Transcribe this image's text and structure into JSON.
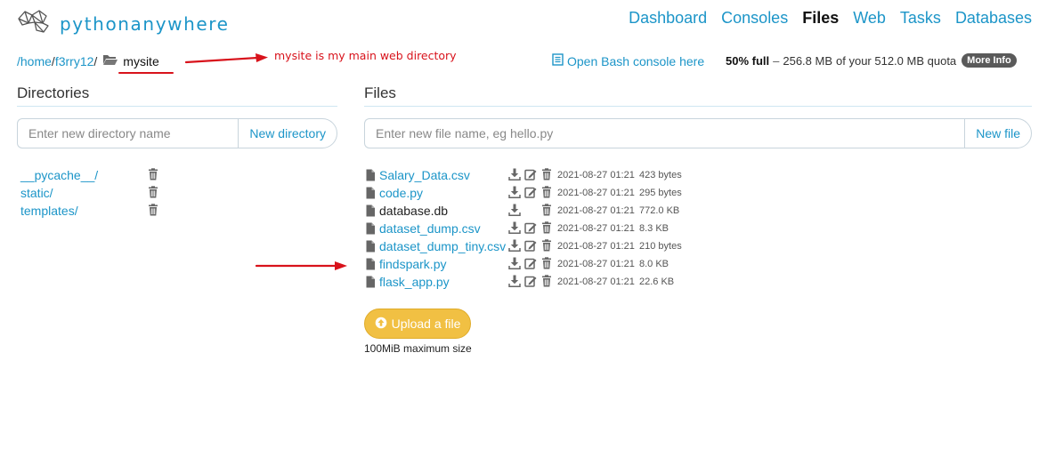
{
  "header": {
    "logo_text": "pythonanywhere",
    "nav": [
      {
        "label": "Dashboard",
        "active": false
      },
      {
        "label": "Consoles",
        "active": false
      },
      {
        "label": "Files",
        "active": true
      },
      {
        "label": "Web",
        "active": false
      },
      {
        "label": "Tasks",
        "active": false
      },
      {
        "label": "Databases",
        "active": false
      }
    ]
  },
  "breadcrumb": {
    "parts": [
      "/home",
      "/",
      "f3rry12",
      "/"
    ],
    "current": "mysite"
  },
  "annotation": {
    "text": "mysite is my main web directory",
    "color": "#d8121b"
  },
  "bash_link": "Open Bash console here",
  "quota": {
    "percent": "50% full",
    "dash": "–",
    "used": "256.8 MB",
    "of_text": "of your 512.0 MB quota",
    "more_info": "More Info"
  },
  "directories": {
    "title": "Directories",
    "placeholder": "Enter new directory name",
    "button": "New directory",
    "items": [
      "__pycache__/",
      "static/",
      "templates/"
    ]
  },
  "files": {
    "title": "Files",
    "placeholder": "Enter new file name, eg hello.py",
    "button": "New file",
    "items": [
      {
        "name": "Salary_Data.csv",
        "link": true,
        "edit": true,
        "date": "2021-08-27 01:21",
        "size": "423 bytes"
      },
      {
        "name": "code.py",
        "link": true,
        "edit": true,
        "date": "2021-08-27 01:21",
        "size": "295 bytes"
      },
      {
        "name": "database.db",
        "link": false,
        "edit": false,
        "date": "2021-08-27 01:21",
        "size": "772.0 KB"
      },
      {
        "name": "dataset_dump.csv",
        "link": true,
        "edit": true,
        "date": "2021-08-27 01:21",
        "size": "8.3 KB"
      },
      {
        "name": "dataset_dump_tiny.csv",
        "link": true,
        "edit": true,
        "date": "2021-08-27 01:21",
        "size": "210 bytes"
      },
      {
        "name": "findspark.py",
        "link": true,
        "edit": true,
        "date": "2021-08-27 01:21",
        "size": "8.0 KB"
      },
      {
        "name": "flask_app.py",
        "link": true,
        "edit": true,
        "date": "2021-08-27 01:21",
        "size": "22.6 KB"
      }
    ],
    "upload_label": "Upload a file",
    "upload_note": "100MiB maximum size"
  },
  "colors": {
    "link": "#1c95c8",
    "upload": "#f1c043",
    "arrow": "#d8121b"
  }
}
